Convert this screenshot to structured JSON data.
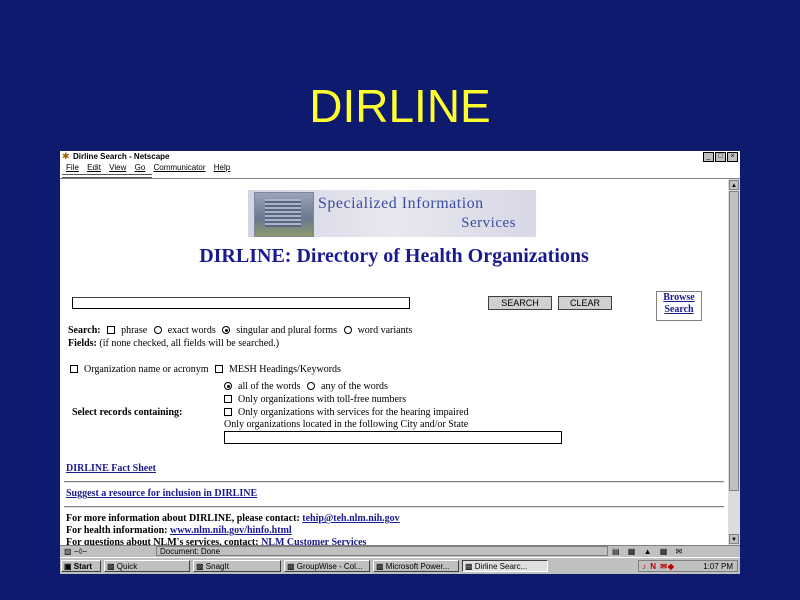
{
  "slide": {
    "title": "DIRLINE"
  },
  "window": {
    "title": "Dirline Search - Netscape",
    "controls": [
      "_",
      "□",
      "×"
    ]
  },
  "menu": [
    "File",
    "Edit",
    "View",
    "Go",
    "Communicator",
    "Help"
  ],
  "banner": {
    "line1": "Specialized Information",
    "line2": "Services"
  },
  "page": {
    "heading": "DIRLINE: Directory of Health Organizations",
    "search_button": "SEARCH",
    "clear_button": "CLEAR",
    "browse_line1": "Browse",
    "browse_line2": "Search",
    "search_label": "Search:",
    "search_opts": {
      "phrase": "phrase",
      "exact": "exact words",
      "singular": "singular and plural forms",
      "variants": "word variants"
    },
    "fields_label": "Fields:",
    "fields_note": "(if none checked, all fields will be searched.)",
    "field_org": "Organization name or acronym",
    "field_mesh": "MESH Headings/Keywords",
    "all_words": "all of the words",
    "any_words": "any of the words",
    "select_label": "Select records containing:",
    "tollfree": "Only organizations with toll-free numbers",
    "hearing": "Only organizations with services for the hearing impaired",
    "city_label": "Only organizations located in the following City and/or State",
    "fact_sheet": "DIRLINE Fact Sheet",
    "suggest": "Suggest a resource for inclusion in DIRLINE",
    "more_info_label": "For more information about DIRLINE, please contact:",
    "more_info_email": "tehip@teh.nlm.nih.gov",
    "health_label": "For health information:",
    "health_url": "www.nlm.nih.gov/hinfo.html",
    "questions_label": "For questions about NLM's services, contact:",
    "questions_link": "NLM Customer Services"
  },
  "statusbar": {
    "text": "Document: Done"
  },
  "taskbar": {
    "start": "Start",
    "tasks": [
      "Quick",
      "SnagIt",
      "GroupWise - Col...",
      "Microsoft Power...",
      "Dirline Searc..."
    ],
    "clock": "1:07 PM"
  },
  "colors": {
    "slide_bg": "#0d1a6e",
    "slide_title": "#ffff2e",
    "heading": "#1a1a90",
    "link": "#1a1a90"
  }
}
